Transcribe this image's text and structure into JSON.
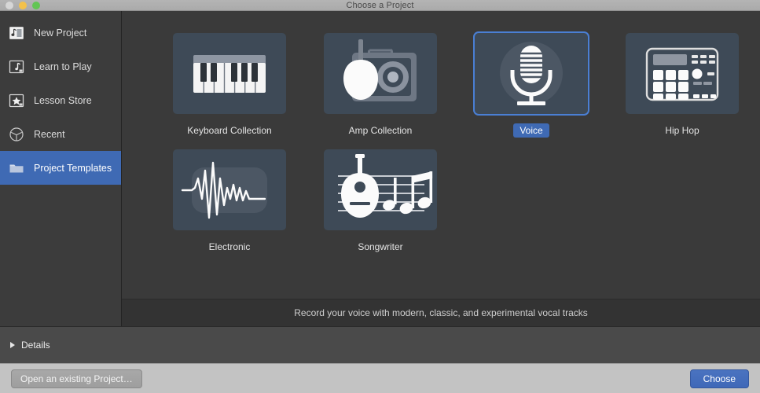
{
  "window": {
    "title": "Choose a Project",
    "traffic_lights": [
      {
        "name": "close",
        "color": "#d6d6d6"
      },
      {
        "name": "minimize",
        "color": "#f3c14b"
      },
      {
        "name": "maximize",
        "color": "#62c554"
      }
    ]
  },
  "sidebar": {
    "items": [
      {
        "label": "New Project",
        "icon": "new-project-icon",
        "selected": false
      },
      {
        "label": "Learn to Play",
        "icon": "learn-to-play-icon",
        "selected": false
      },
      {
        "label": "Lesson Store",
        "icon": "lesson-store-icon",
        "selected": false
      },
      {
        "label": "Recent",
        "icon": "clock-icon",
        "selected": false
      },
      {
        "label": "Project Templates",
        "icon": "folder-icon",
        "selected": true
      }
    ]
  },
  "main": {
    "templates": [
      {
        "label": "Keyboard Collection",
        "icon": "keyboard-icon",
        "selected": false
      },
      {
        "label": "Amp Collection",
        "icon": "amp-guitar-icon",
        "selected": false
      },
      {
        "label": "Voice",
        "icon": "microphone-icon",
        "selected": true
      },
      {
        "label": "Hip Hop",
        "icon": "drum-machine-icon",
        "selected": false
      },
      {
        "label": "Electronic",
        "icon": "waveform-icon",
        "selected": false
      },
      {
        "label": "Songwriter",
        "icon": "songwriter-icon",
        "selected": false
      }
    ],
    "description": "Record your voice with modern, classic, and experimental vocal tracks"
  },
  "details": {
    "label": "Details",
    "expanded": false
  },
  "actions": {
    "open_existing_label": "Open an existing Project…",
    "choose_label": "Choose"
  },
  "colors": {
    "accent": "#3f6ab4",
    "selection_border": "#4a7fd4",
    "tile_background": "#3e4a57",
    "panel_background": "#3a3a3a",
    "sidebar_background": "#3c3c3c"
  }
}
